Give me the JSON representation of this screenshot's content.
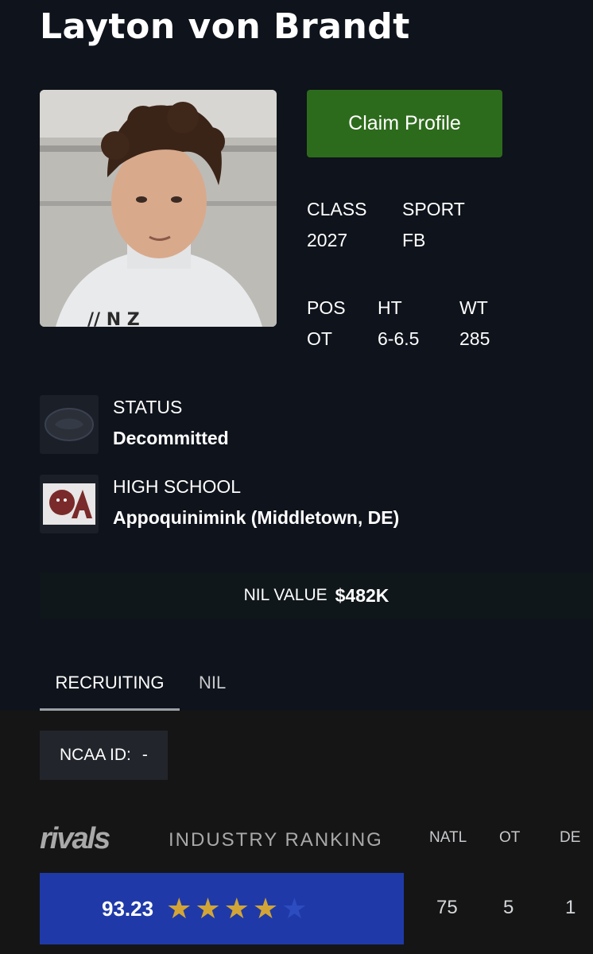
{
  "player": {
    "name": "Layton von Brandt",
    "claim_label": "Claim Profile"
  },
  "stats": {
    "class_label": "CLASS",
    "class_value": "2027",
    "sport_label": "SPORT",
    "sport_value": "FB",
    "pos_label": "POS",
    "pos_value": "OT",
    "ht_label": "HT",
    "ht_value": "6-6.5",
    "wt_label": "WT",
    "wt_value": "285"
  },
  "status": {
    "label": "STATUS",
    "value": "Decommitted",
    "icon": "school-logo-icon"
  },
  "high_school": {
    "label": "HIGH SCHOOL",
    "value": "Appoquinimink (Middletown, DE)",
    "icon": "jaguar-logo-icon"
  },
  "nil": {
    "label": "NIL VALUE",
    "value": "$482K"
  },
  "tabs": [
    {
      "label": "RECRUITING",
      "active": true
    },
    {
      "label": "NIL",
      "active": false
    }
  ],
  "ncaa": {
    "label": "NCAA ID:",
    "value": "-"
  },
  "ranking": {
    "brand": "rivals",
    "title": "INDUSTRY RANKING",
    "score": "93.23",
    "stars_filled": 4,
    "stars_total": 5,
    "columns": [
      {
        "header": "NATL",
        "value": "75"
      },
      {
        "header": "OT",
        "value": "5"
      },
      {
        "header": "DE",
        "value": "1"
      }
    ],
    "colors": {
      "box": "#1f3aa8",
      "star_on": "#d3a536",
      "star_off": "#2d4cc0"
    }
  },
  "colors": {
    "claim_button": "#2d6b1c",
    "background": "#0f131b"
  }
}
